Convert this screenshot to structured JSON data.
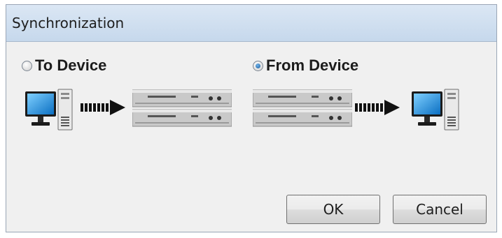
{
  "dialog": {
    "title": "Synchronization",
    "options": {
      "to_device": {
        "label": "To Device",
        "selected": false
      },
      "from_device": {
        "label": "From Device",
        "selected": true
      }
    },
    "buttons": {
      "ok": "OK",
      "cancel": "Cancel"
    }
  },
  "icons": {
    "computer": "computer-icon",
    "device": "rack-device-icon",
    "arrow": "transfer-arrow-icon"
  },
  "colors": {
    "title_bar": "#c6d8ec",
    "dialog_bg": "#f0f0f0",
    "radio_selected": "#1d5c9c"
  }
}
